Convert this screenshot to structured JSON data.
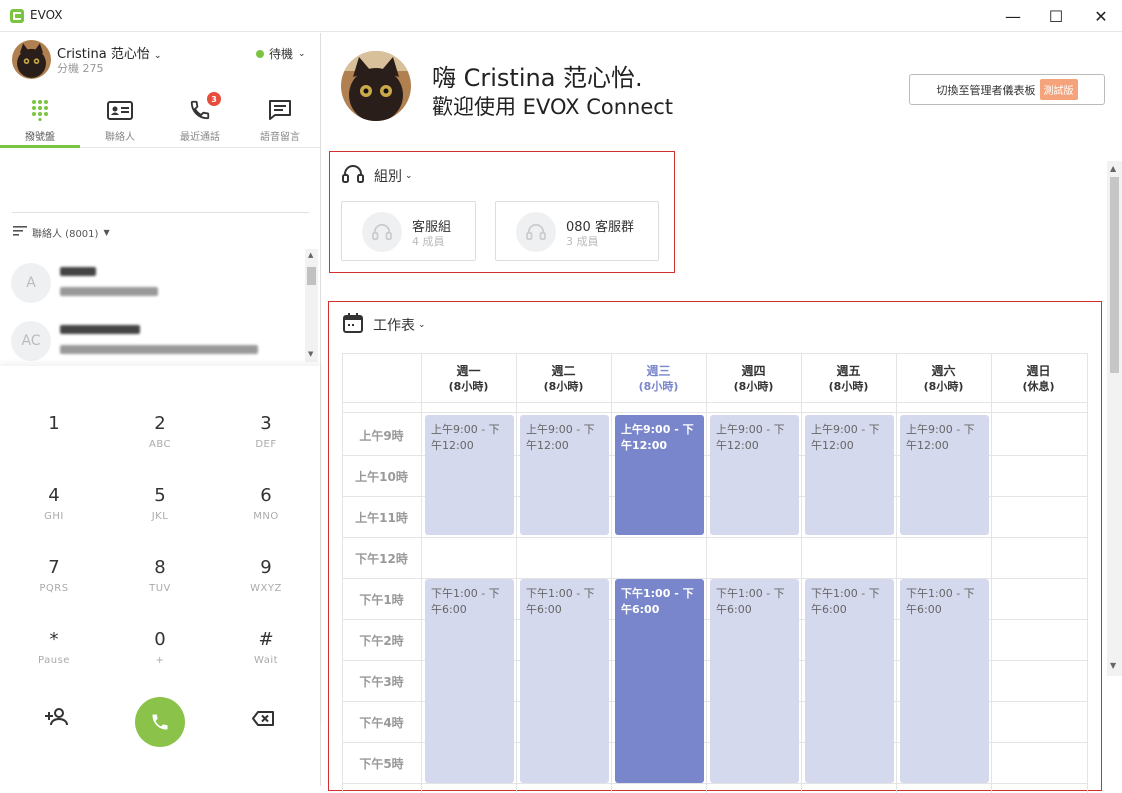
{
  "window": {
    "title": "EVOX",
    "minimize": "—",
    "maximize": "☐",
    "close": "✕"
  },
  "me": {
    "name": "Cristina 范心怡",
    "extension": "分機 275",
    "status": "待機"
  },
  "tabs": [
    {
      "label": "撥號盤",
      "icon": "dialpad-icon",
      "active": true
    },
    {
      "label": "聯絡人",
      "icon": "contacts-card-icon"
    },
    {
      "label": "最近通話",
      "icon": "phone-icon",
      "badge": "3"
    },
    {
      "label": "語音留言",
      "icon": "voicemail-chat-icon"
    }
  ],
  "contacts": {
    "header": "聯絡人 (8001)",
    "items": [
      {
        "initials": "A"
      },
      {
        "initials": "AC"
      }
    ]
  },
  "dialpad": {
    "keys": [
      {
        "digit": "1",
        "sub": ""
      },
      {
        "digit": "2",
        "sub": "ABC"
      },
      {
        "digit": "3",
        "sub": "DEF"
      },
      {
        "digit": "4",
        "sub": "GHI"
      },
      {
        "digit": "5",
        "sub": "JKL"
      },
      {
        "digit": "6",
        "sub": "MNO"
      },
      {
        "digit": "7",
        "sub": "PQRS"
      },
      {
        "digit": "8",
        "sub": "TUV"
      },
      {
        "digit": "9",
        "sub": "WXYZ"
      },
      {
        "digit": "*",
        "sub": "Pause"
      },
      {
        "digit": "0",
        "sub": "+"
      },
      {
        "digit": "#",
        "sub": "Wait"
      }
    ]
  },
  "greeting": {
    "line1": "嗨 Cristina 范心怡.",
    "line2": "歡迎使用 EVOX Connect"
  },
  "switch_button": {
    "label": "切換至管理者儀表板",
    "beta": "測試版"
  },
  "groups": {
    "title": "組別",
    "items": [
      {
        "name": "客服組",
        "members": "4 成員"
      },
      {
        "name": "080 客服群",
        "members": "3 成員"
      }
    ]
  },
  "schedule": {
    "title": "工作表",
    "days": [
      {
        "name": "週一",
        "hours": "(8小時)"
      },
      {
        "name": "週二",
        "hours": "(8小時)"
      },
      {
        "name": "週三",
        "hours": "(8小時)",
        "today": true
      },
      {
        "name": "週四",
        "hours": "(8小時)"
      },
      {
        "name": "週五",
        "hours": "(8小時)"
      },
      {
        "name": "週六",
        "hours": "(8小時)"
      },
      {
        "name": "週日",
        "hours": "(休息)"
      }
    ],
    "hours": [
      "上午9時",
      "上午10時",
      "上午11時",
      "下午12時",
      "下午1時",
      "下午2時",
      "下午3時",
      "下午4時",
      "下午5時"
    ],
    "morning_block": "上午9:00 - 下午12:00",
    "afternoon_block": "下午1:00 - 下午6:00"
  },
  "colors": {
    "accent_green": "#7bc442",
    "schedule_block": "#d5d9ee",
    "today_block": "#7986cb",
    "highlight_border": "#d32f2f"
  }
}
